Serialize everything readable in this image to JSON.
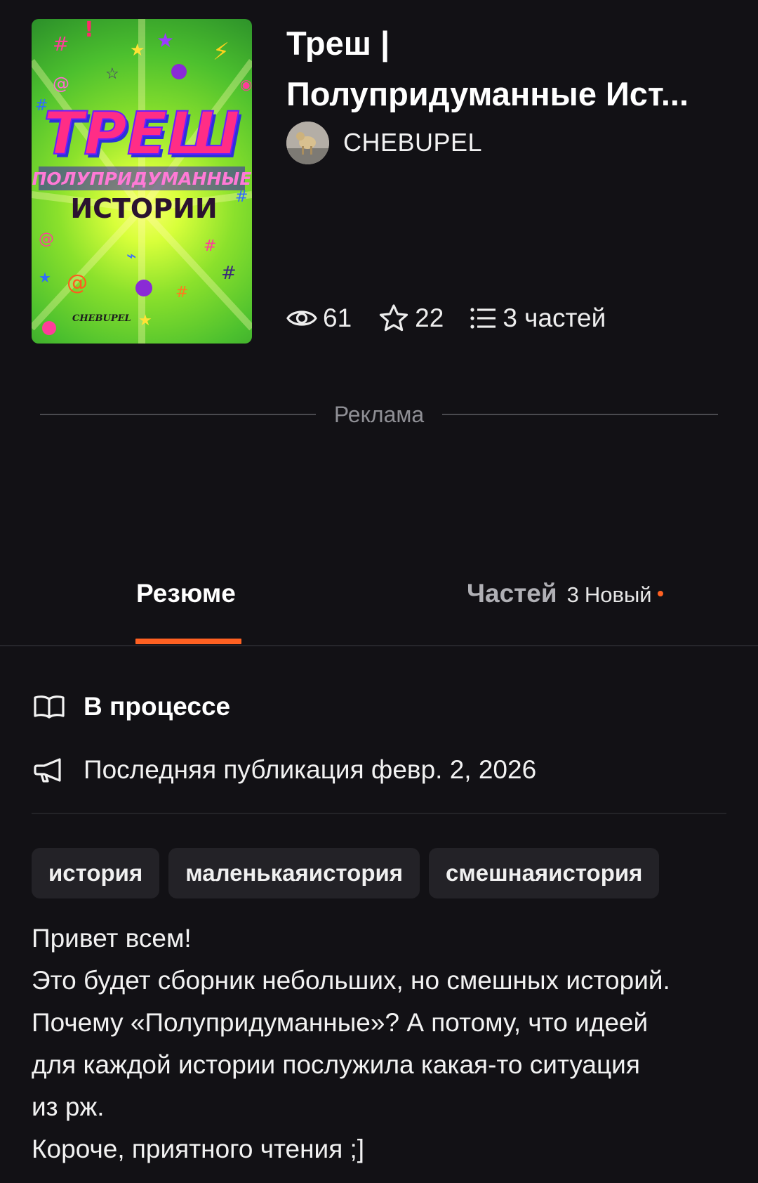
{
  "story": {
    "title_line1": "Треш |",
    "title_line2": "Полупридуманные Ист...",
    "author": "CHEBUPEL",
    "cover": {
      "title_big": "ТРЕШ",
      "title_sub1": "ПОЛУПРИДУМАННЫЕ",
      "title_sub2": "ИСТОРИИ",
      "signature": "CHEBUPEL"
    }
  },
  "stats": {
    "views": "61",
    "votes": "22",
    "parts": "3 частей"
  },
  "ad": {
    "label": "Реклама"
  },
  "tabs": {
    "summary": "Резюме",
    "parts": "Частей",
    "parts_count": "3",
    "parts_new": "Новый"
  },
  "details": {
    "status": "В процессе",
    "last_published": "Последняя публикация февр. 2, 2026"
  },
  "tags": [
    "история",
    "маленькаяистория",
    "смешнаяистория"
  ],
  "description": [
    "Привет всем!",
    "Это будет сборник небольших, но смешных историй.",
    "Почему «Полупридуманные»? А потому, что идеей",
    "для каждой истории послужила какая-то ситуация",
    "из рж.",
    "Короче, приятного чтения ;]"
  ],
  "colors": {
    "background": "#121115",
    "accent": "#ff6122",
    "tag_background": "#232227",
    "muted_text": "#8f8f95"
  },
  "icons": [
    "eye-icon",
    "star-icon",
    "list-icon",
    "book-icon",
    "megaphone-icon"
  ]
}
